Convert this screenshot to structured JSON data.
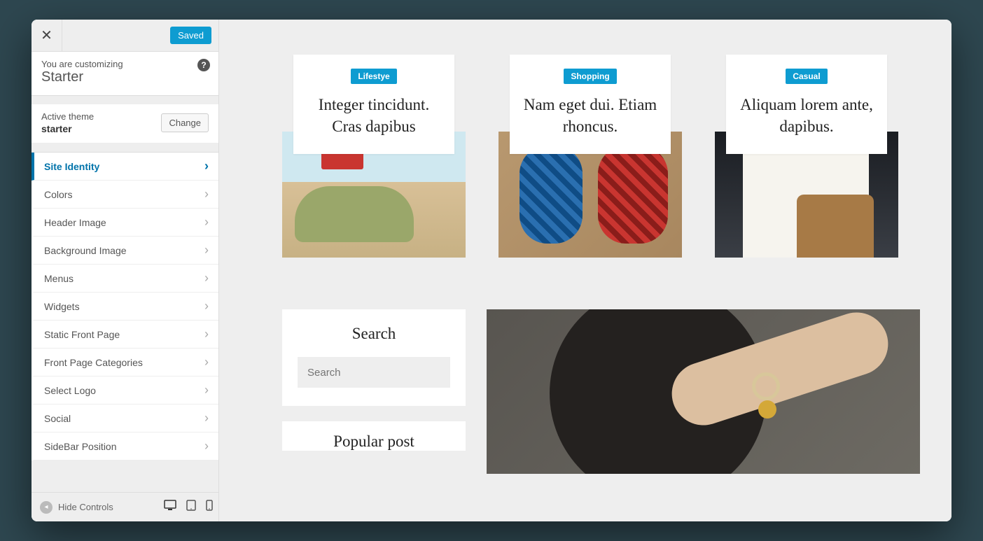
{
  "customizer": {
    "saved_label": "Saved",
    "customizing_label": "You are customizing",
    "site_title": "Starter",
    "active_theme_label": "Active theme",
    "active_theme_name": "starter",
    "change_label": "Change",
    "menu_items": [
      {
        "label": "Site Identity",
        "active": true
      },
      {
        "label": "Colors",
        "active": false
      },
      {
        "label": "Header Image",
        "active": false
      },
      {
        "label": "Background Image",
        "active": false
      },
      {
        "label": "Menus",
        "active": false
      },
      {
        "label": "Widgets",
        "active": false
      },
      {
        "label": "Static Front Page",
        "active": false
      },
      {
        "label": "Front Page Categories",
        "active": false
      },
      {
        "label": "Select Logo",
        "active": false
      },
      {
        "label": "Social",
        "active": false
      },
      {
        "label": "SideBar Position",
        "active": false
      }
    ],
    "hide_controls_label": "Hide Controls"
  },
  "preview": {
    "cards": [
      {
        "badge": "Lifestye",
        "title": "Integer tincidunt. Cras dapibus"
      },
      {
        "badge": "Shopping",
        "title": "Nam eget dui. Etiam rhoncus."
      },
      {
        "badge": "Casual",
        "title": "Aliquam lorem ante, dapibus."
      }
    ],
    "search_heading": "Search",
    "search_placeholder": "Search",
    "popular_heading": "Popular post"
  },
  "colors": {
    "accent": "#0e9cd1",
    "link": "#0073aa"
  }
}
